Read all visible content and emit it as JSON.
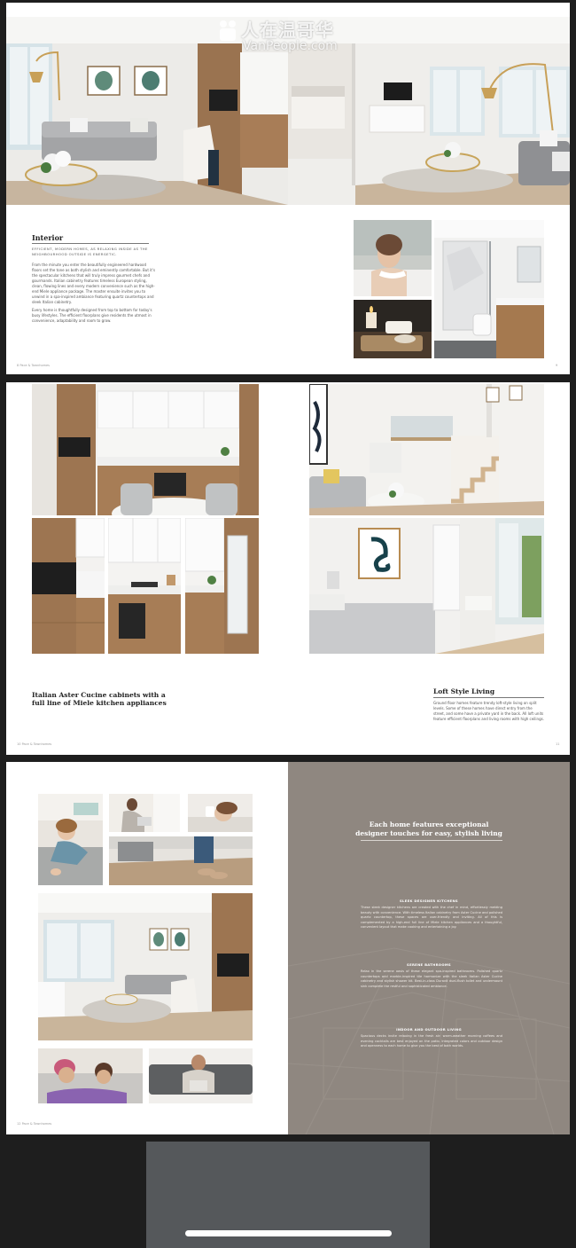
{
  "watermark": {
    "title": "人在温哥华",
    "subtitle": "VanPeople.com"
  },
  "page1": {
    "heading": "Interior",
    "subheading": "EFFICIENT, MODERN HOMES, AS RELAXING INSIDE AS THE NEIGHBOURHOOD OUTSIDE IS ENERGETIC.",
    "para1": "From the minute you enter the beautifully engineered hardwood floors set the tone as both stylish and eminently comfortable. But it's the spectacular kitchens that will truly impress gourmet chefs and gourmands. Italian cabinetry features timeless European styling, clean, flowing lines and every modern convenience such as the high-end Miele appliance package. The master ensuite invites you to unwind in a spa-inspired ambiance featuring quartz countertops and sleek Italian cabinetry.",
    "para2": "Every home is thoughtfully designed from top to bottom for today's busy lifestyles. The efficient floorplans give residents the utmost in convenience, adaptability and room to grow.",
    "footer_left": "8 Pace & Townhomes",
    "footer_right": "9"
  },
  "page2": {
    "kitchen_caption": "Italian Aster Cucine cabinets with a full line of Miele kitchen appliances",
    "loft_title": "Loft Style Living",
    "loft_text": "Ground floor homes feature trendy loft-style living on split levels. Some of these homes have direct entry from the street, and some have a private yard in the back. All loft units feature efficient floorplans and living rooms with high ceilings.",
    "footer_left": "10 Pace & Townhomes",
    "footer_right": "11"
  },
  "page3": {
    "title_line1": "Each home features exceptional",
    "title_line2": "designer touches for easy, stylish living",
    "sections": [
      {
        "heading": "SLEEK DESIGNER KITCHENS",
        "text": "These sleek designer kitchens are created with the chef in mind, effortlessly melding beauty with convenience. With timeless Italian cabinetry from Aster Cucine and polished quartz countertop, these spaces are user-friendly and inviting. All of this is complemented by a high-end full line of Miele kitchen appliances and a thoughtful, convenient layout that make cooking and entertaining a joy."
      },
      {
        "heading": "SERENE BATHROOMS",
        "text": "Relax in the serene oasis of these elegant spa-inspired bathrooms. Polished quartz countertops and marble-inspired tile harmonize with the sleek Italian Aster Cucine cabinetry and stylish shower kit. Best-in-class Duravit dual-flush toilet and undermount sink complete the restful and sophisticated ambiance."
      },
      {
        "heading": "INDOOR AND OUTDOOR LIVING",
        "text": "Spacious decks invite relaxing in the fresh air: warm-weather morning coffees and evening cocktails are best enjoyed on the patio. Integrated colors and outdoor design and openness to each home to give you the best of both worlds."
      }
    ],
    "footer_left": "12 Pace & Townhomes"
  },
  "colors": {
    "page_bg": "#1e1e1e",
    "panel_taupe": "#8f8780",
    "wood": "#9a7350",
    "dark_panel": "#55585b"
  }
}
